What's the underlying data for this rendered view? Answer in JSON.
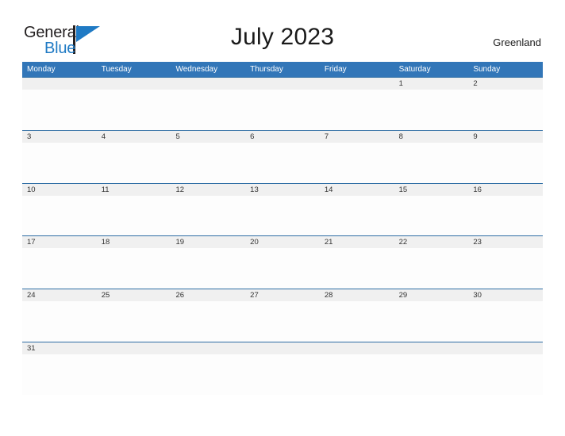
{
  "brand": {
    "name_part1": "General",
    "name_part2": "Blue",
    "flag_icon": "blue-triangle-flag-icon",
    "accent_color": "#1f7ac4"
  },
  "header": {
    "title": "July 2023",
    "country": "Greenland"
  },
  "theme": {
    "header_blue": "#3276b8",
    "rule_blue": "#2e6da4",
    "strip_gray": "#f0f0f0",
    "text_dark": "#333333"
  },
  "calendar": {
    "month": "July",
    "year": "2023",
    "weekday_headers": [
      "Monday",
      "Tuesday",
      "Wednesday",
      "Thursday",
      "Friday",
      "Saturday",
      "Sunday"
    ],
    "weeks": [
      [
        "",
        "",
        "",
        "",
        "",
        "1",
        "2"
      ],
      [
        "3",
        "4",
        "5",
        "6",
        "7",
        "8",
        "9"
      ],
      [
        "10",
        "11",
        "12",
        "13",
        "14",
        "15",
        "16"
      ],
      [
        "17",
        "18",
        "19",
        "20",
        "21",
        "22",
        "23"
      ],
      [
        "24",
        "25",
        "26",
        "27",
        "28",
        "29",
        "30"
      ],
      [
        "31",
        "",
        "",
        "",
        "",
        "",
        ""
      ]
    ]
  }
}
